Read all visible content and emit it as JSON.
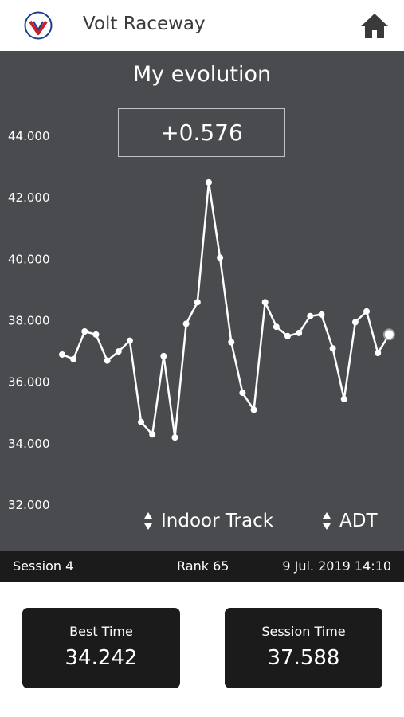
{
  "header": {
    "app_title": "Volt Raceway",
    "logo_text": "Volt Raceway",
    "home_icon": "home-icon"
  },
  "evolution": {
    "title": "My evolution",
    "delta": "+0.576",
    "track_selector": "Indoor Track",
    "kart_selector": "ADT"
  },
  "chart_data": {
    "type": "line",
    "title": "My evolution",
    "xlabel": "",
    "ylabel": "",
    "ylim": [
      32,
      44
    ],
    "yticks": [
      "32.000",
      "34.000",
      "36.000",
      "38.000",
      "40.000",
      "42.000",
      "44.000"
    ],
    "grid": false,
    "series": [
      {
        "values": [
          36.9,
          36.75,
          37.65,
          37.55,
          36.7,
          37.0,
          37.35,
          34.7,
          34.3,
          36.85,
          34.2,
          37.9,
          38.6,
          42.5,
          40.05,
          37.3,
          35.65,
          35.1,
          38.6,
          37.8,
          37.5,
          37.6,
          38.15,
          38.2,
          37.1,
          35.45,
          37.95,
          38.3,
          36.95,
          37.55
        ]
      }
    ],
    "line_color": "#ffffff",
    "background": "#4a4b4f"
  },
  "session_bar": {
    "session": "Session 4",
    "rank": "Rank 65",
    "datetime": "9 Jul. 2019 14:10"
  },
  "cards": {
    "best_label": "Best Time",
    "best_value": "34.242",
    "session_label": "Session Time",
    "session_value": "37.588"
  }
}
